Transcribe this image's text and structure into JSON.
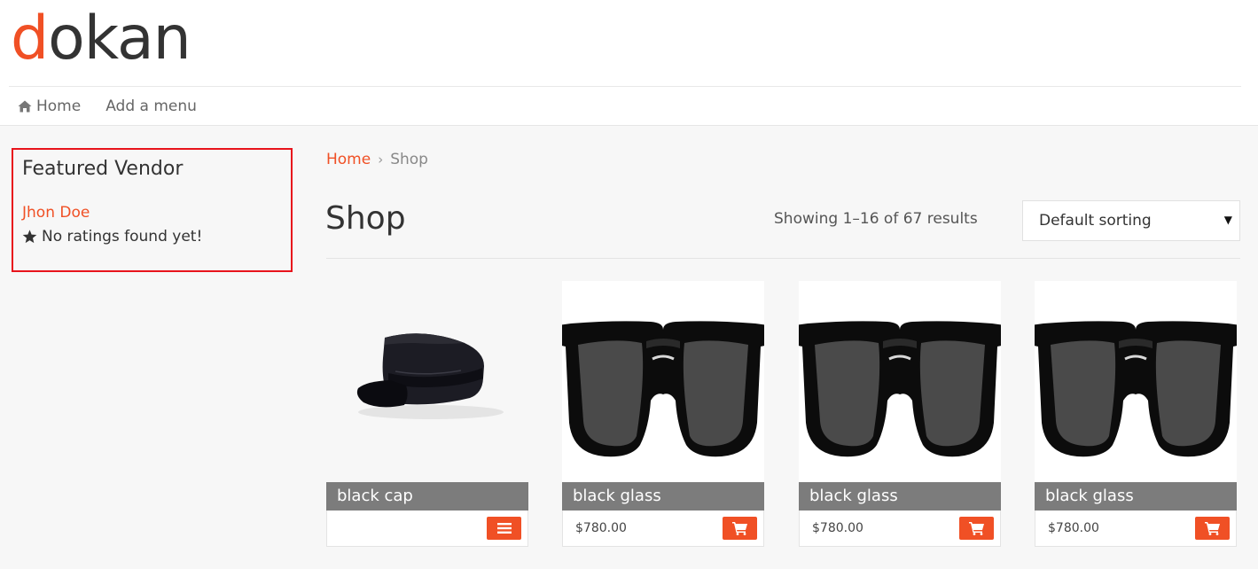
{
  "logo": {
    "first_letter": "d",
    "rest": "okan"
  },
  "nav": {
    "items": [
      {
        "label": "Home",
        "icon": "home-icon"
      },
      {
        "label": "Add a menu"
      }
    ]
  },
  "sidebar": {
    "widget_title": "Featured Vendor",
    "vendor_name": "Jhon Doe",
    "rating_text": "No ratings found yet!",
    "rating_icon": "star-icon"
  },
  "breadcrumb": {
    "home": "Home",
    "separator": "›",
    "current": "Shop"
  },
  "page_title": "Shop",
  "result_count": "Showing 1–16 of 67 results",
  "sort": {
    "selected": "Default sorting"
  },
  "products": [
    {
      "title": "black cap",
      "price": "",
      "button_icon": "menu-icon",
      "image": "cap-image"
    },
    {
      "title": "black glass",
      "price": "$780.00",
      "button_icon": "cart-icon",
      "image": "sunglasses-image"
    },
    {
      "title": "black glass",
      "price": "$780.00",
      "button_icon": "cart-icon",
      "image": "sunglasses-image"
    },
    {
      "title": "black glass",
      "price": "$780.00",
      "button_icon": "cart-icon",
      "image": "sunglasses-image"
    }
  ],
  "colors": {
    "accent": "#f05025",
    "highlight_border": "#e8141c",
    "title_bar": "#7c7c7c"
  }
}
